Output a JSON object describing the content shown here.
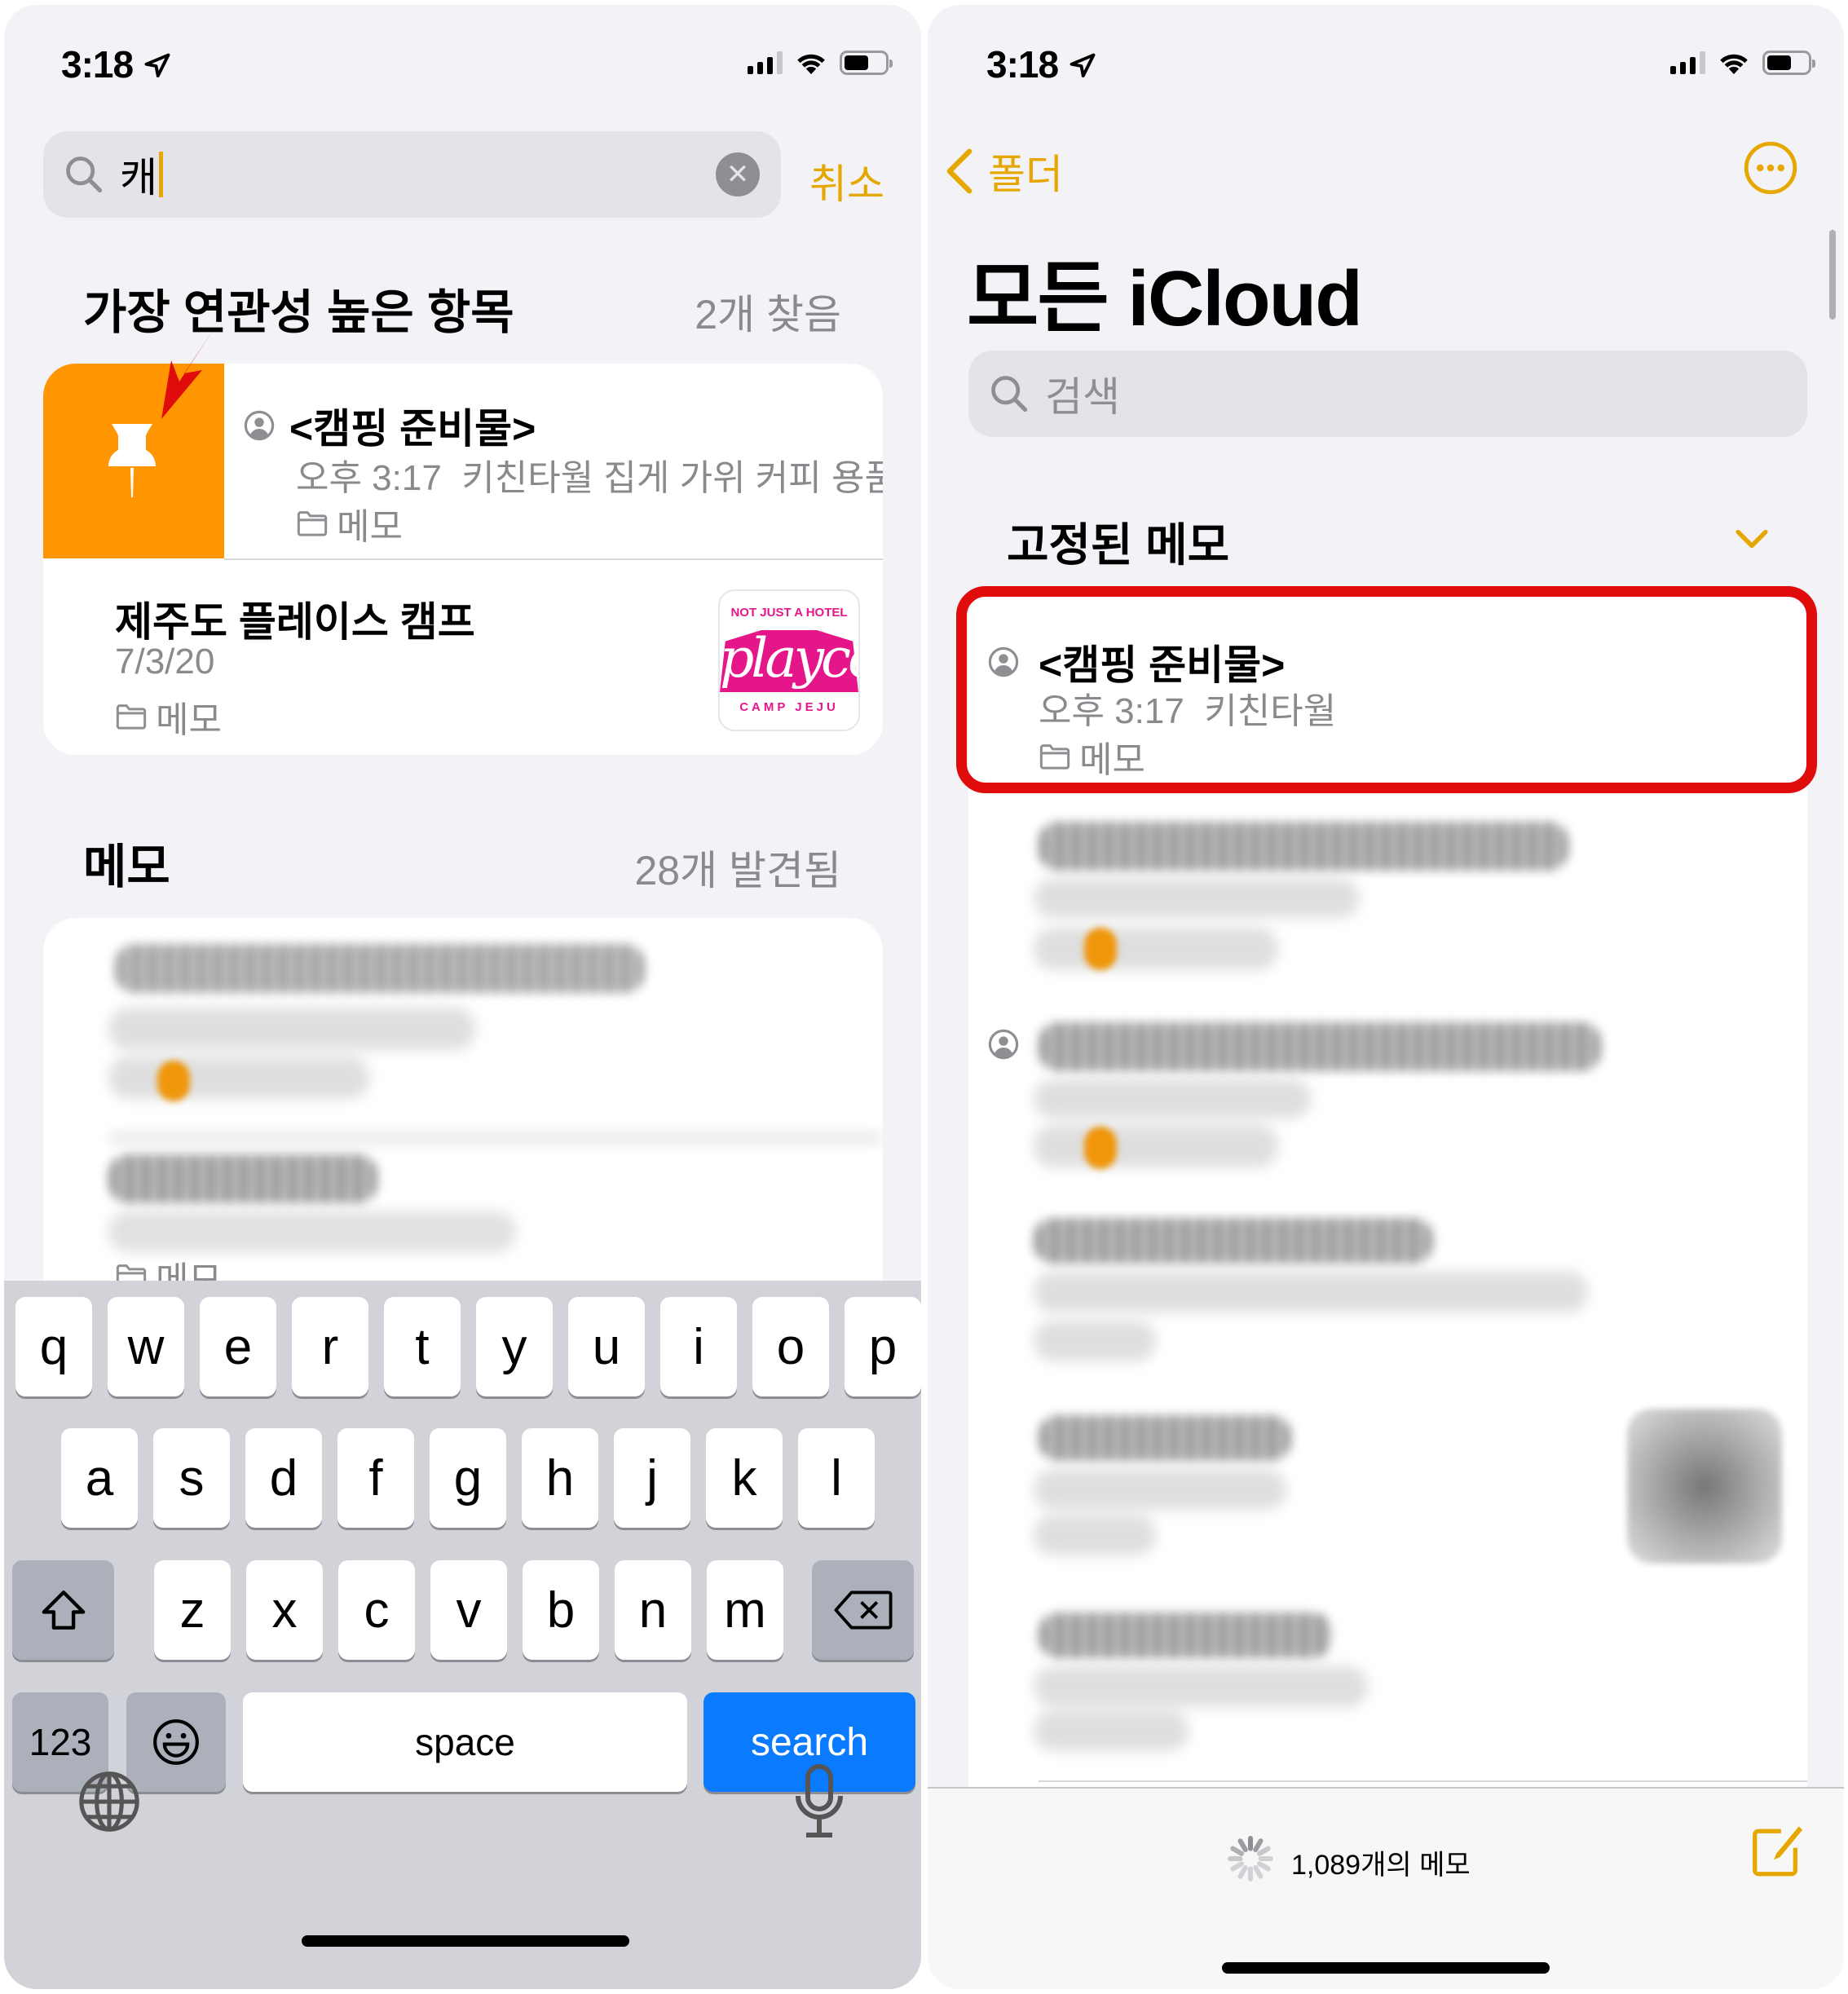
{
  "left_screen": {
    "status_bar": {
      "time": "3:18"
    },
    "search": {
      "query": "캐",
      "cancel_label": "취소"
    },
    "top_hits": {
      "title": "가장 연관성 높은 항목",
      "count": "2개 찾음",
      "items": [
        {
          "title": "<캠핑 준비물>",
          "time": "오후 3:17",
          "preview": "키친타월 집게 가위 커피 용품(",
          "folder": "메모",
          "pinned": true,
          "shared": true
        },
        {
          "title": "제주도 플레이스 캠프",
          "time": "7/3/20",
          "folder": "메모",
          "thumbnail": {
            "top_text": "NOT JUST A HOTEL",
            "brand": "playce",
            "bottom_text": "CAMP JEJU",
            "color": "#e5168a"
          }
        }
      ]
    },
    "notes_section": {
      "title": "메모",
      "count": "28개 발견됨",
      "last_folder": "메모"
    },
    "keyboard": {
      "row1": [
        "q",
        "w",
        "e",
        "r",
        "t",
        "y",
        "u",
        "i",
        "o",
        "p"
      ],
      "row2": [
        "a",
        "s",
        "d",
        "f",
        "g",
        "h",
        "j",
        "k",
        "l"
      ],
      "row3": [
        "z",
        "x",
        "c",
        "v",
        "b",
        "n",
        "m"
      ],
      "numbers_label": "123",
      "space_label": "space",
      "search_label": "search"
    }
  },
  "right_screen": {
    "status_bar": {
      "time": "3:18"
    },
    "nav": {
      "back_label": "폴더"
    },
    "title": "모든 iCloud",
    "search": {
      "placeholder": "검색"
    },
    "pinned_section": {
      "title": "고정된 메모"
    },
    "pinned_note": {
      "title": "<캠핑 준비물>",
      "time": "오후 3:17",
      "preview": "키친타월",
      "folder": "메모"
    },
    "footer": {
      "count_label": "1,089개의 메모"
    }
  },
  "colors": {
    "accent": "#e6a800",
    "pin_orange": "#ff9500",
    "highlight_red": "#e00b0b",
    "keyboard_blue": "#0a7aff"
  }
}
